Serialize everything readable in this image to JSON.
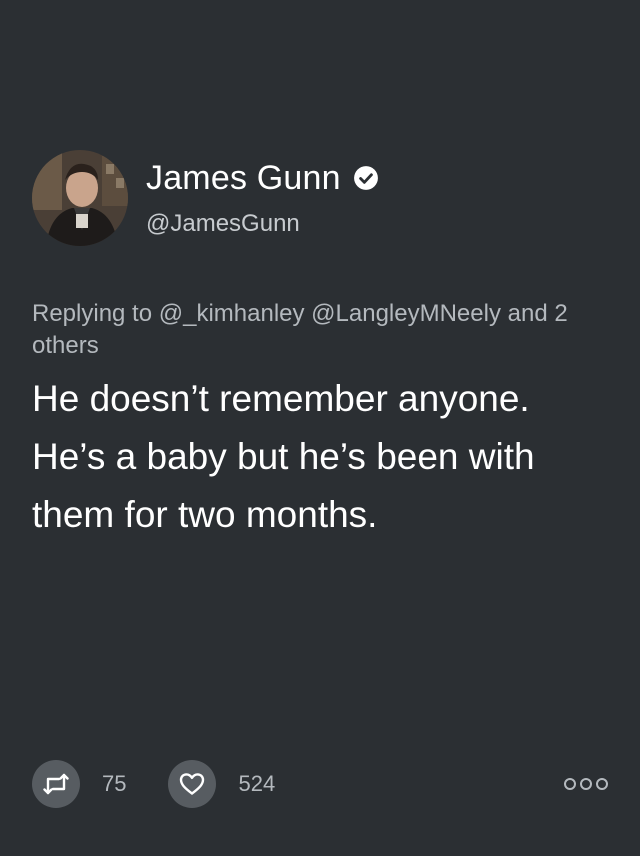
{
  "tweet": {
    "display_name": "James Gunn",
    "handle": "@JamesGunn",
    "verified": true,
    "replying_to": "Replying to @_kimhanley @LangleyMNeely and 2 others",
    "text": "He doesn’t remember anyone. He’s a baby but he’s been with them for two months."
  },
  "actions": {
    "retweet_count": "75",
    "like_count": "524"
  },
  "colors": {
    "background": "#2b2f33",
    "primary_text": "#ffffff",
    "secondary_text": "#b4b9be",
    "action_button_bg": "#575c61"
  },
  "icons": {
    "verified": "verified-badge-icon",
    "retweet": "retweet-icon",
    "like": "heart-icon",
    "more": "more-options-icon"
  }
}
